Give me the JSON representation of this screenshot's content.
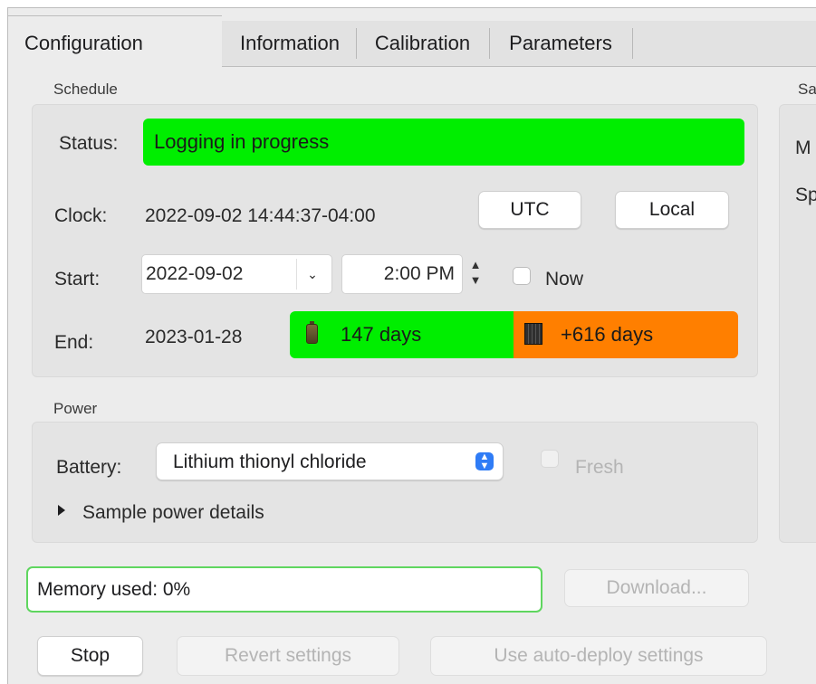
{
  "tabs": [
    "Configuration",
    "Information",
    "Calibration",
    "Parameters"
  ],
  "schedule": {
    "section_label": "Schedule",
    "status_label": "Status:",
    "status_value": "Logging in progress",
    "clock_label": "Clock:",
    "clock_value": "2022-09-02 14:44:37-04:00",
    "utc_button": "UTC",
    "local_button": "Local",
    "start_label": "Start:",
    "start_date": "2022-09-02",
    "start_time": "2:00 PM",
    "now_label": "Now",
    "end_label": "End:",
    "end_date": "2023-01-28",
    "battery_days": "147 days",
    "memory_days": "+616 days"
  },
  "power": {
    "section_label": "Power",
    "battery_label": "Battery:",
    "battery_value": "Lithium thionyl chloride",
    "fresh_label": "Fresh",
    "details_label": "Sample power details"
  },
  "right_panel": {
    "section_label_partial": "Sa",
    "row1_partial": "M",
    "row2_partial": "Sp"
  },
  "memory": {
    "used_text": "Memory used: 0%",
    "download_button": "Download..."
  },
  "actions": {
    "stop_button": "Stop",
    "revert_button": "Revert settings",
    "autodeploy_button": "Use auto-deploy settings"
  },
  "colors": {
    "status_green": "#00ee00",
    "memory_orange": "#ff7f00",
    "select_accent": "#2f7cf6"
  },
  "icons": [
    "battery-icon",
    "memory-card-icon",
    "chevron-down-icon",
    "stepper-icon",
    "disclosure-triangle-icon",
    "select-arrows-icon"
  ]
}
